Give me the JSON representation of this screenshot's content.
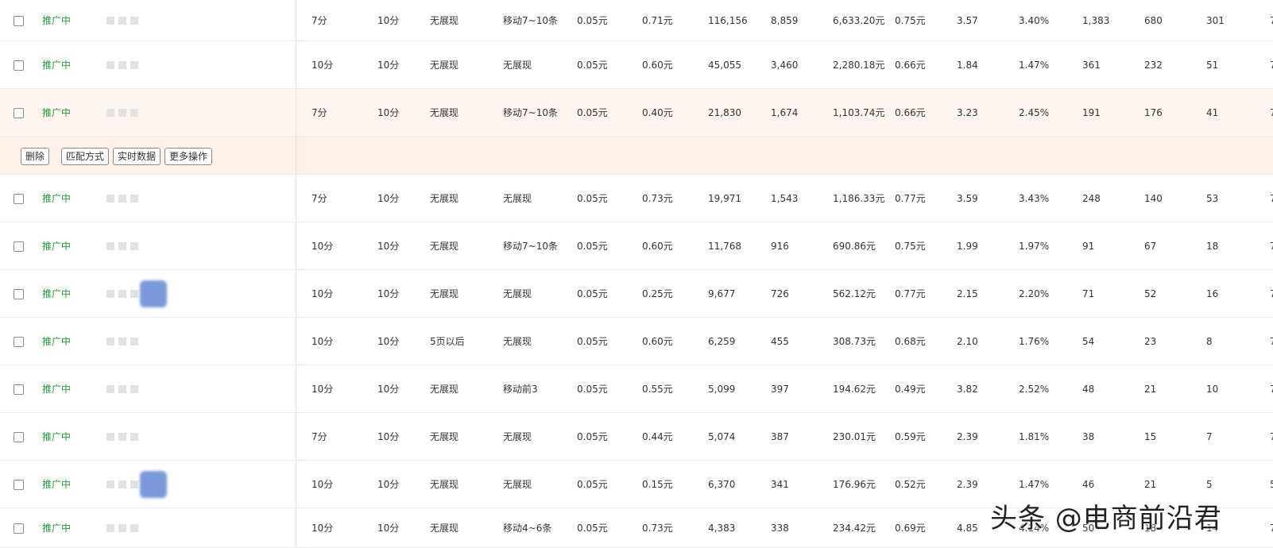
{
  "rows": [
    {
      "status": "推广中",
      "c1": "7分",
      "c2": "10分",
      "c3": "无展现",
      "c4": "移动7~10条",
      "c5": "0.05元",
      "c6": "0.71元",
      "c7": "116,156",
      "c8": "8,859",
      "c9": "6,633.20元",
      "c10": "0.75元",
      "c11": "3.57",
      "c12": "3.40%",
      "c13": "1,383",
      "c14": "680",
      "c15": "301",
      "c16": "7"
    },
    {
      "status": "推广中",
      "c1": "10分",
      "c2": "10分",
      "c3": "无展现",
      "c4": "无展现",
      "c5": "0.05元",
      "c6": "0.60元",
      "c7": "45,055",
      "c8": "3,460",
      "c9": "2,280.18元",
      "c10": "0.66元",
      "c11": "1.84",
      "c12": "1.47%",
      "c13": "361",
      "c14": "232",
      "c15": "51",
      "c16": "7"
    },
    {
      "status": "推广中",
      "c1": "7分",
      "c2": "10分",
      "c3": "无展现",
      "c4": "移动7~10条",
      "c5": "0.05元",
      "c6": "0.40元",
      "c7": "21,830",
      "c8": "1,674",
      "c9": "1,103.74元",
      "c10": "0.66元",
      "c11": "3.23",
      "c12": "2.45%",
      "c13": "191",
      "c14": "176",
      "c15": "41",
      "c16": "7"
    },
    {
      "status": "推广中",
      "c1": "7分",
      "c2": "10分",
      "c3": "无展现",
      "c4": "无展现",
      "c5": "0.05元",
      "c6": "0.73元",
      "c7": "19,971",
      "c8": "1,543",
      "c9": "1,186.33元",
      "c10": "0.77元",
      "c11": "3.59",
      "c12": "3.43%",
      "c13": "248",
      "c14": "140",
      "c15": "53",
      "c16": "7"
    },
    {
      "status": "推广中",
      "c1": "10分",
      "c2": "10分",
      "c3": "无展现",
      "c4": "移动7~10条",
      "c5": "0.05元",
      "c6": "0.60元",
      "c7": "11,768",
      "c8": "916",
      "c9": "690.86元",
      "c10": "0.75元",
      "c11": "1.99",
      "c12": "1.97%",
      "c13": "91",
      "c14": "67",
      "c15": "18",
      "c16": "7"
    },
    {
      "status": "推广中",
      "c1": "10分",
      "c2": "10分",
      "c3": "无展现",
      "c4": "无展现",
      "c5": "0.05元",
      "c6": "0.25元",
      "c7": "9,677",
      "c8": "726",
      "c9": "562.12元",
      "c10": "0.77元",
      "c11": "2.15",
      "c12": "2.20%",
      "c13": "71",
      "c14": "52",
      "c15": "16",
      "c16": "7"
    },
    {
      "status": "推广中",
      "c1": "10分",
      "c2": "10分",
      "c3": "5页以后",
      "c4": "无展现",
      "c5": "0.05元",
      "c6": "0.60元",
      "c7": "6,259",
      "c8": "455",
      "c9": "308.73元",
      "c10": "0.68元",
      "c11": "2.10",
      "c12": "1.76%",
      "c13": "54",
      "c14": "23",
      "c15": "8",
      "c16": "7"
    },
    {
      "status": "推广中",
      "c1": "10分",
      "c2": "10分",
      "c3": "无展现",
      "c4": "移动前3",
      "c5": "0.05元",
      "c6": "0.55元",
      "c7": "5,099",
      "c8": "397",
      "c9": "194.62元",
      "c10": "0.49元",
      "c11": "3.82",
      "c12": "2.52%",
      "c13": "48",
      "c14": "21",
      "c15": "10",
      "c16": "7"
    },
    {
      "status": "推广中",
      "c1": "7分",
      "c2": "10分",
      "c3": "无展现",
      "c4": "无展现",
      "c5": "0.05元",
      "c6": "0.44元",
      "c7": "5,074",
      "c8": "387",
      "c9": "230.01元",
      "c10": "0.59元",
      "c11": "2.39",
      "c12": "1.81%",
      "c13": "38",
      "c14": "15",
      "c15": "7",
      "c16": "7"
    },
    {
      "status": "推广中",
      "c1": "10分",
      "c2": "10分",
      "c3": "无展现",
      "c4": "无展现",
      "c5": "0.05元",
      "c6": "0.15元",
      "c7": "6,370",
      "c8": "341",
      "c9": "176.96元",
      "c10": "0.52元",
      "c11": "2.39",
      "c12": "1.47%",
      "c13": "46",
      "c14": "21",
      "c15": "5",
      "c16": "5"
    },
    {
      "status": "推广中",
      "c1": "10分",
      "c2": "10分",
      "c3": "无展现",
      "c4": "移动4~6条",
      "c5": "0.05元",
      "c6": "0.73元",
      "c7": "4,383",
      "c8": "338",
      "c9": "234.42元",
      "c10": "0.69元",
      "c11": "4.85",
      "c12": "4.14%",
      "c13": "50",
      "c14": "18",
      "c15": "14",
      "c16": "7"
    }
  ],
  "actions": {
    "delete": "删除",
    "match_mode": "匹配方式",
    "realtime_data": "实时数据",
    "more_actions": "更多操作"
  },
  "watermark": "头条 @电商前沿君"
}
